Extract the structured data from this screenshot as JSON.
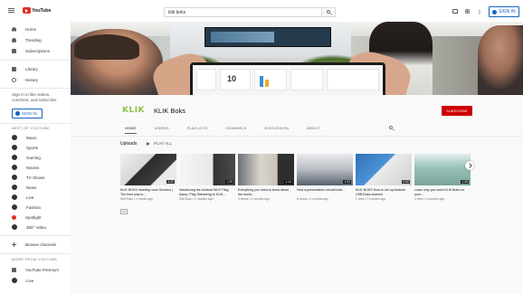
{
  "header": {
    "logo_text": "YouTube",
    "search_value": "klik boks",
    "search_placeholder": "Search",
    "sign_in_label": "SIGN IN"
  },
  "sidebar": {
    "main_items": [
      {
        "label": "Home",
        "icon": "home-icon"
      },
      {
        "label": "Trending",
        "icon": "trending-icon"
      },
      {
        "label": "Subscriptions",
        "icon": "subscriptions-icon"
      }
    ],
    "library_items": [
      {
        "label": "Library",
        "icon": "library-icon"
      },
      {
        "label": "History",
        "icon": "history-icon"
      }
    ],
    "sign_in_prompt": "Sign in to like videos, comment, and subscribe.",
    "sign_in_label": "SIGN IN",
    "best_heading": "BEST OF YOUTUBE",
    "best_items": [
      {
        "label": "Music"
      },
      {
        "label": "Sports"
      },
      {
        "label": "Gaming"
      },
      {
        "label": "Movies"
      },
      {
        "label": "TV Shows"
      },
      {
        "label": "News"
      },
      {
        "label": "Live"
      },
      {
        "label": "Fashion"
      },
      {
        "label": "Spotlight"
      },
      {
        "label": "360° Video"
      }
    ],
    "browse_label": "Browse channels",
    "more_heading": "MORE FROM YOUTUBE",
    "more_items": [
      {
        "label": "YouTube Premium"
      },
      {
        "label": "Live"
      }
    ]
  },
  "banner": {
    "tablet_number": "10"
  },
  "channel": {
    "logo_text": "KLIK",
    "name": "KLIK Boks",
    "subscribe_label": "SUBSCRIBE",
    "tabs": [
      "HOME",
      "VIDEOS",
      "PLAYLISTS",
      "CHANNELS",
      "DISCUSSION",
      "ABOUT"
    ],
    "active_tab": "HOME"
  },
  "shelf": {
    "title": "Uploads",
    "play_all": "PLAY ALL",
    "videos": [
      {
        "title": "KLIK BOKS meeting room Solution | The best way to...",
        "meta": "Klik Boks • 1 month ago",
        "duration": "1:21",
        "cc": "CC"
      },
      {
        "title": "Introducing the Android Wi-Fi Plug &amp; Play Streaming to KLIK...",
        "meta": "Klik Boks • 2 months ago",
        "duration": "1:29",
        "cc": ""
      },
      {
        "title": "Everything you need to know about the world...",
        "meta": "4 views • 2 months ago",
        "duration": "1:14",
        "cc": ""
      },
      {
        "title": "How a presentation should look...",
        "meta": "6 views • 2 months ago",
        "duration": "1:03",
        "cc": ""
      },
      {
        "title": "KLIK BOKS How to set up Android USB Boks channel",
        "meta": "1 view • 2 months ago",
        "duration": "0:52",
        "cc": ""
      },
      {
        "title": "Learn why you need KLIK Boks on your...",
        "meta": "1 view • 2 months ago",
        "duration": "1:45",
        "cc": ""
      }
    ]
  },
  "colors": {
    "brand_red": "#e52d27",
    "subscribe_red": "#cc0000",
    "link_blue": "#1565c0",
    "klik_green": "#8bc34a"
  }
}
